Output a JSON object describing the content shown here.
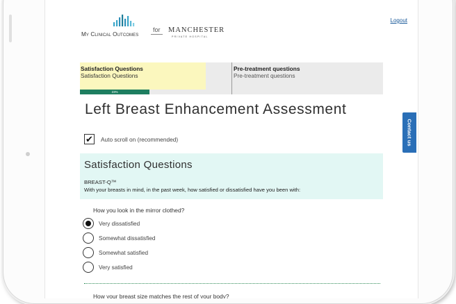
{
  "header": {
    "logout_label": "Logout",
    "brand": "My Clinical Outcomes",
    "for_label": "for",
    "hospital_name": "MANCHESTER",
    "hospital_sub": "PRIVATE HOSPITAL",
    "brand_color": "#1e7e9a"
  },
  "progress": {
    "current_title": "Satisfaction Questions",
    "current_sub": "Satisfaction Questions",
    "next_title": "Pre-treatment questions",
    "next_sub": "Pre-treatment questions",
    "percent_label": "23%",
    "percent_value": 23,
    "fill_color": "#1e7e60"
  },
  "page_title": "Left Breast Enhancement Assessment",
  "autoscroll": {
    "checked": true,
    "label": "Auto scroll on (recommended)"
  },
  "section": {
    "title": "Satisfaction Questions",
    "source": "BREAST-Q™",
    "instruction": "With your breasts in mind, in the past week, how satisfied or dissatisfied have you been with:"
  },
  "questions": [
    {
      "text": "How you look in the mirror clothed?",
      "options": [
        {
          "label": "Very dissatisfied",
          "selected": true
        },
        {
          "label": "Somewhat dissatisfied",
          "selected": false
        },
        {
          "label": "Somewhat satisfied",
          "selected": false
        },
        {
          "label": "Very satisfied",
          "selected": false
        }
      ]
    },
    {
      "text": "How your breast size matches the rest of your body?"
    }
  ],
  "contact_label": "Contact us"
}
